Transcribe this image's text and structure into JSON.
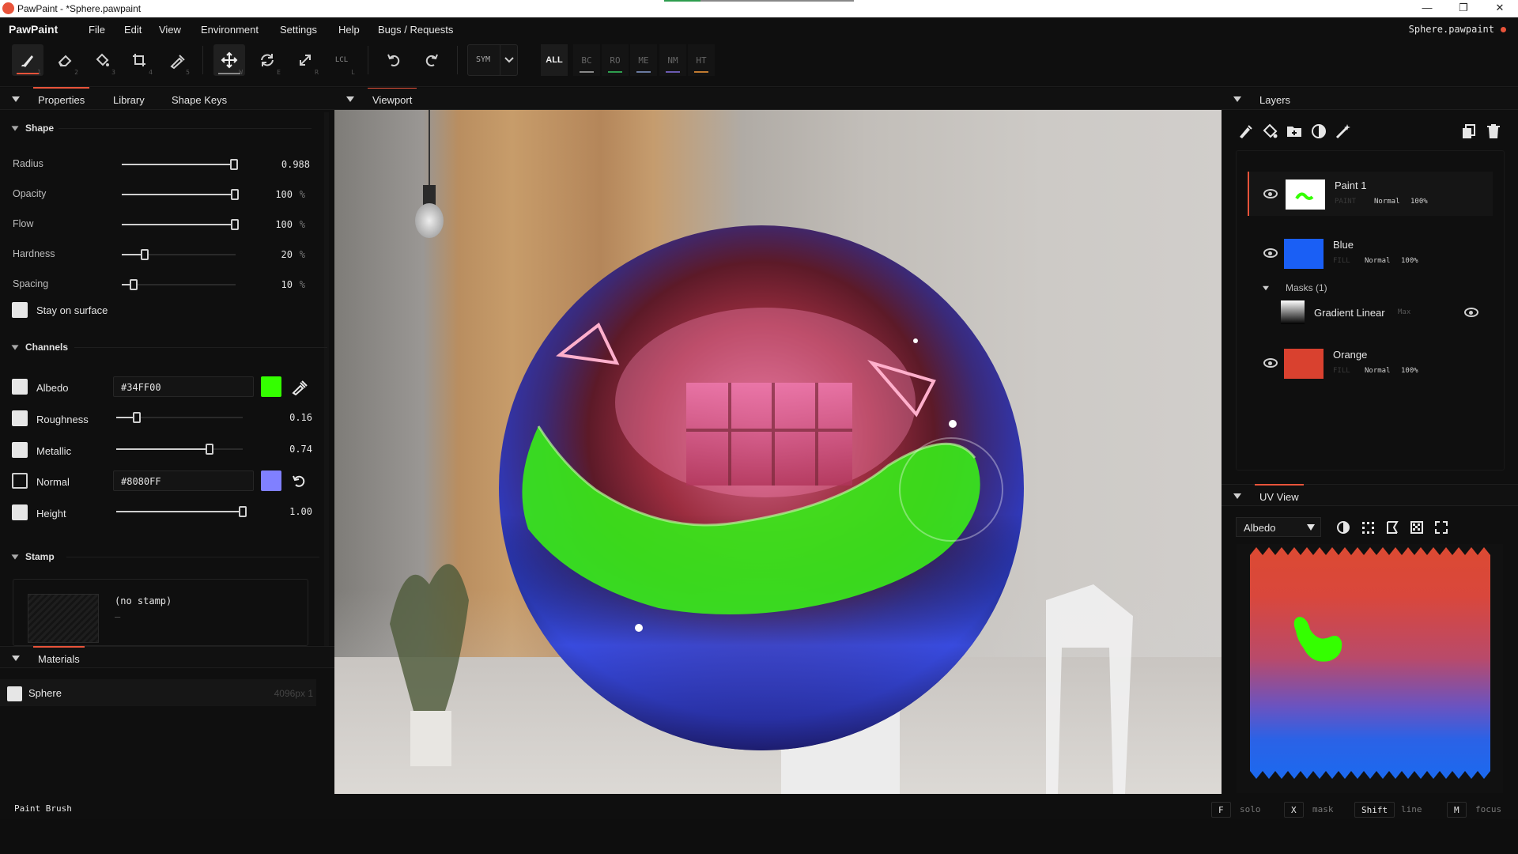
{
  "window": {
    "title": "PawPaint - *Sphere.pawpaint",
    "minimize": "—",
    "restore": "❐",
    "close": "✕"
  },
  "menubar": {
    "brand": "PawPaint",
    "items": [
      "File",
      "Edit",
      "View",
      "Environment",
      "Settings",
      "Help",
      "Bugs / Requests"
    ],
    "filename": "Sphere.pawpaint"
  },
  "toolbar": {
    "tools": [
      {
        "name": "paint-brush",
        "key": "1"
      },
      {
        "name": "eraser",
        "key": "2"
      },
      {
        "name": "fill",
        "key": "3"
      },
      {
        "name": "crop",
        "key": "4"
      },
      {
        "name": "eyedropper",
        "key": "5"
      },
      {
        "name": "move",
        "key": "W"
      },
      {
        "name": "rotate",
        "key": "E"
      },
      {
        "name": "scale",
        "key": "R"
      }
    ],
    "local_label": "LCL",
    "local_key": "L",
    "sym_label": "SYM",
    "channels": [
      {
        "label": "ALL",
        "color": ""
      },
      {
        "label": "BC",
        "color": "#888888"
      },
      {
        "label": "RO",
        "color": "#2e9d4e"
      },
      {
        "label": "ME",
        "color": "#6a7aa0"
      },
      {
        "label": "NM",
        "color": "#6a5ab0"
      },
      {
        "label": "HT",
        "color": "#c07a30"
      }
    ]
  },
  "left_panel": {
    "tabs": [
      "Properties",
      "Library",
      "Shape Keys"
    ],
    "shape": {
      "title": "Shape",
      "radius": {
        "label": "Radius",
        "value": "0.988",
        "level": 0.98
      },
      "opacity": {
        "label": "Opacity",
        "value": "100",
        "unit": "%",
        "level": 1.0
      },
      "flow": {
        "label": "Flow",
        "value": "100",
        "unit": "%",
        "level": 1.0
      },
      "hardness": {
        "label": "Hardness",
        "value": "20",
        "unit": "%",
        "level": 0.2
      },
      "spacing": {
        "label": "Spacing",
        "value": "10",
        "unit": "%",
        "level": 0.1
      },
      "stay_on_surface": "Stay on surface"
    },
    "channels": {
      "title": "Channels",
      "albedo": {
        "label": "Albedo",
        "hex": "#34FF00",
        "color": "#34FF00"
      },
      "roughness": {
        "label": "Roughness",
        "value": "0.16",
        "level": 0.16
      },
      "metallic": {
        "label": "Metallic",
        "value": "0.74",
        "level": 0.74
      },
      "normal": {
        "label": "Normal",
        "hex": "#8080FF",
        "color": "#8080FF"
      },
      "height": {
        "label": "Height",
        "value": "1.00",
        "level": 1.0
      }
    },
    "stamp": {
      "title": "Stamp",
      "name": "(no stamp)",
      "sub": "–"
    }
  },
  "materials": {
    "title": "Materials",
    "items": [
      {
        "name": "Sphere",
        "meta": "4096px 1"
      }
    ]
  },
  "viewport": {
    "title": "Viewport"
  },
  "layers": {
    "title": "Layers",
    "items": [
      {
        "name": "Paint 1",
        "type": "PAINT",
        "blend": "Normal",
        "opacity": "100%"
      },
      {
        "name": "Blue",
        "type": "FILL",
        "blend": "Normal",
        "opacity": "100%",
        "color": "#1a5ff5"
      },
      {
        "name": "Orange",
        "type": "FILL",
        "blend": "Normal",
        "opacity": "100%",
        "color": "#d9412f"
      }
    ],
    "masks_label": "Masks (1)",
    "mask": {
      "name": "Gradient Linear",
      "mode": "Max"
    }
  },
  "uv_view": {
    "title": "UV View",
    "channel": "Albedo"
  },
  "status": {
    "tool": "Paint Brush",
    "hints": [
      {
        "key": "F",
        "label": "solo"
      },
      {
        "key": "X",
        "label": "mask"
      },
      {
        "key": "Shift",
        "label": "line"
      },
      {
        "key": "M",
        "label": "focus"
      }
    ]
  }
}
